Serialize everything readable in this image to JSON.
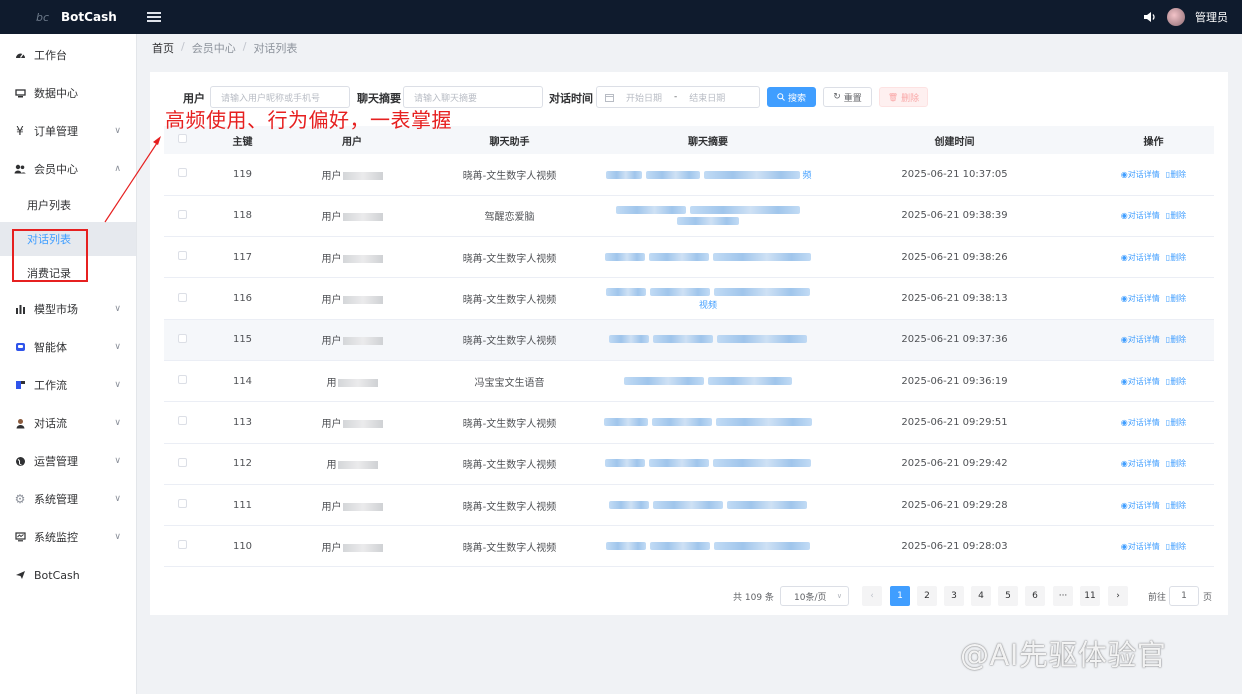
{
  "app": {
    "logo_text": "bc",
    "name": "BotCash"
  },
  "header": {
    "user_name": "管理员",
    "icons": [
      "menu-toggle-icon",
      "speaker-icon"
    ]
  },
  "sidebar": {
    "items": [
      {
        "label": "工作台",
        "icon": "dashboard-icon"
      },
      {
        "label": "数据中心",
        "icon": "data-icon"
      },
      {
        "label": "订单管理",
        "icon": "yen-icon",
        "chevron": "down"
      },
      {
        "label": "会员中心",
        "icon": "member-icon",
        "chevron": "up",
        "children": [
          {
            "label": "用户列表"
          },
          {
            "label": "对话列表",
            "active": true
          },
          {
            "label": "消费记录"
          }
        ]
      },
      {
        "label": "模型市场",
        "icon": "bar-chart-icon",
        "chevron": "down"
      },
      {
        "label": "智能体",
        "icon": "agent-icon",
        "chevron": "down"
      },
      {
        "label": "工作流",
        "icon": "workflow-icon",
        "chevron": "down"
      },
      {
        "label": "对话流",
        "icon": "chatflow-icon",
        "chevron": "down"
      },
      {
        "label": "运营管理",
        "icon": "globe-icon",
        "chevron": "down"
      },
      {
        "label": "系统管理",
        "icon": "gear-icon",
        "chevron": "down"
      },
      {
        "label": "系统监控",
        "icon": "monitor-icon",
        "chevron": "down"
      },
      {
        "label": "BotCash",
        "icon": "send-icon"
      }
    ]
  },
  "breadcrumb": {
    "home": "首页",
    "level1": "会员中心",
    "level2": "对话列表",
    "separator": "/"
  },
  "filters": {
    "user_label": "用户",
    "user_placeholder": "请输入用户昵称或手机号",
    "summary_label": "聊天摘要",
    "summary_placeholder": "请输入聊天摘要",
    "time_label": "对话时间",
    "start_placeholder": "开始日期",
    "range_sep": "-",
    "end_placeholder": "结束日期",
    "search_label": "搜索",
    "reset_label": "重置",
    "delete_label": "删除"
  },
  "annotation": {
    "text": "高频使用、行为偏好，一表掌握",
    "color": "#e62020"
  },
  "table": {
    "columns": [
      "主键",
      "用户",
      "聊天助手",
      "聊天摘要",
      "创建时间",
      "操作"
    ],
    "rows": [
      {
        "id": "119",
        "user_prefix": "用户",
        "assistant": "晓苒-文生数字人视频",
        "summary_tail": "频",
        "created": "2025-06-21 10:37:05"
      },
      {
        "id": "118",
        "user_prefix": "用户",
        "assistant": "驾醒恋爱脑",
        "summary_tail": "",
        "created": "2025-06-21 09:38:39"
      },
      {
        "id": "117",
        "user_prefix": "用户",
        "assistant": "晓苒-文生数字人视频",
        "summary_tail": "",
        "created": "2025-06-21 09:38:26"
      },
      {
        "id": "116",
        "user_prefix": "用户",
        "assistant": "晓苒-文生数字人视频",
        "summary_tail": "视频",
        "created": "2025-06-21 09:38:13"
      },
      {
        "id": "115",
        "user_prefix": "用户",
        "assistant": "晓苒-文生数字人视频",
        "summary_tail": "",
        "created": "2025-06-21 09:37:36"
      },
      {
        "id": "114",
        "user_prefix": "用",
        "assistant": "冯宝宝文生语音",
        "summary_tail": "",
        "created": "2025-06-21 09:36:19"
      },
      {
        "id": "113",
        "user_prefix": "用户",
        "assistant": "晓苒-文生数字人视频",
        "summary_tail": "",
        "created": "2025-06-21 09:29:51"
      },
      {
        "id": "112",
        "user_prefix": "用",
        "assistant": "晓苒-文生数字人视频",
        "summary_tail": "",
        "created": "2025-06-21 09:29:42"
      },
      {
        "id": "111",
        "user_prefix": "用户",
        "assistant": "晓苒-文生数字人视频",
        "summary_tail": "",
        "created": "2025-06-21 09:29:28"
      },
      {
        "id": "110",
        "user_prefix": "用户",
        "assistant": "晓苒-文生数字人视频",
        "summary_tail": "",
        "created": "2025-06-21 09:28:03"
      }
    ],
    "highlighted_row": 4,
    "op_detail": "对话详情",
    "op_delete": "删除"
  },
  "pagination": {
    "total_text": "共 109 条",
    "page_size": "10条/页",
    "pages": [
      "1",
      "2",
      "3",
      "4",
      "5",
      "6",
      "···",
      "11"
    ],
    "current": "1",
    "goto_prefix": "前往",
    "goto_value": "1",
    "goto_suffix": "页"
  },
  "watermark": "@AI先驱体验官",
  "colors": {
    "primary": "#409eff",
    "topbar": "#0f1b2d",
    "annotation": "#e62020"
  }
}
